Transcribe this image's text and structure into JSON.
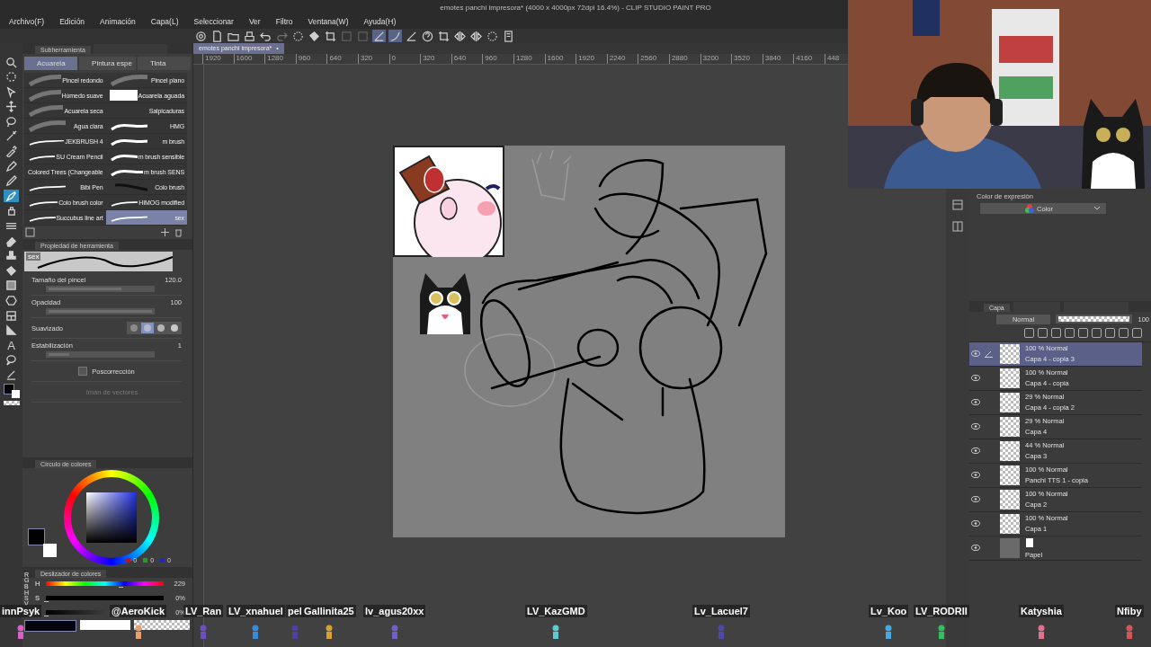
{
  "window": {
    "title": "emotes panchi impresora* (4000 x 4000px 72dpi 16.4%) - CLIP STUDIO PAINT PRO"
  },
  "menu": [
    "Archivo(F)",
    "Edición",
    "Animación",
    "Capa(L)",
    "Seleccionar",
    "Ver",
    "Filtro",
    "Ventana(W)",
    "Ayuda(H)"
  ],
  "toolbar": [
    {
      "kind": "spiral",
      "selected": false
    },
    {
      "kind": "new",
      "selected": false
    },
    {
      "kind": "open",
      "selected": false
    },
    {
      "kind": "print",
      "selected": false
    },
    {
      "kind": "undo",
      "selected": false
    },
    {
      "kind": "redo",
      "selected": false
    },
    {
      "kind": "dots",
      "selected": false
    },
    {
      "kind": "bucket",
      "selected": false
    },
    {
      "kind": "crop",
      "selected": false
    },
    {
      "kind": "square",
      "selected": false
    },
    {
      "kind": "square",
      "selected": false
    },
    {
      "kind": "ruler",
      "selected": true
    },
    {
      "kind": "curve",
      "selected": true
    },
    {
      "kind": "ruler",
      "selected": false
    },
    {
      "kind": "help",
      "selected": false
    },
    {
      "kind": "crop",
      "selected": false
    },
    {
      "kind": "flip",
      "selected": false
    },
    {
      "kind": "flip",
      "selected": false
    },
    {
      "kind": "dots",
      "selected": false
    },
    {
      "kind": "tablet",
      "selected": false
    }
  ],
  "document_tab": {
    "label": "emotes panchi impresora*",
    "close": "•"
  },
  "ruler": [
    "1920",
    "1600",
    "1280",
    "960",
    "640",
    "320",
    "0",
    "320",
    "640",
    "960",
    "1280",
    "1600",
    "1920",
    "2240",
    "2560",
    "2880",
    "3200",
    "3520",
    "3840",
    "4160",
    "448"
  ],
  "tools": [
    {
      "kind": "search",
      "selected": false
    },
    {
      "kind": "dotted",
      "selected": false
    },
    {
      "kind": "cursor",
      "selected": false
    },
    {
      "kind": "move",
      "selected": false
    },
    {
      "kind": "lasso",
      "selected": false
    },
    {
      "kind": "wand",
      "selected": false
    },
    {
      "kind": "dropper",
      "selected": false
    },
    {
      "kind": "pen",
      "selected": false
    },
    {
      "kind": "pencil",
      "selected": false
    },
    {
      "kind": "brush",
      "selected": true
    },
    {
      "kind": "airbrush",
      "selected": false
    },
    {
      "kind": "lines",
      "selected": false
    },
    {
      "kind": "eraser",
      "selected": false
    },
    {
      "kind": "stamp",
      "selected": false
    },
    {
      "kind": "bucket",
      "selected": false
    },
    {
      "kind": "gradient",
      "selected": false
    },
    {
      "kind": "hexagon",
      "selected": false
    },
    {
      "kind": "frame",
      "selected": false
    },
    {
      "kind": "ruler",
      "selected": false
    },
    {
      "kind": "text",
      "glyph": "A",
      "selected": false
    },
    {
      "kind": "balloon",
      "selected": false
    },
    {
      "kind": "line",
      "selected": false
    }
  ],
  "subtool": {
    "title": "Subherramienta",
    "groups": [
      {
        "label": "Acuarela",
        "selected": true
      },
      {
        "label": "Pintura espe",
        "selected": false
      },
      {
        "label": "Tinta",
        "selected": false
      }
    ],
    "brushes": [
      {
        "name": "Pincel redondo",
        "kind": "soft",
        "selected": false
      },
      {
        "name": "Pincel plano",
        "kind": "soft",
        "selected": false
      },
      {
        "name": "Húmedo suave",
        "kind": "soft",
        "selected": false
      },
      {
        "name": "Acuarela aguada",
        "kind": "block",
        "selected": false
      },
      {
        "name": "Acuarela seca",
        "kind": "soft",
        "selected": false
      },
      {
        "name": "Salpicaduras",
        "kind": "none",
        "selected": false
      },
      {
        "name": "Agua clara",
        "kind": "soft",
        "selected": false
      },
      {
        "name": "HMG",
        "kind": "wave",
        "selected": false
      },
      {
        "name": "JEKBRUSH 4",
        "kind": "line",
        "selected": false
      },
      {
        "name": "m brush",
        "kind": "wave",
        "selected": false
      },
      {
        "name": "SU Cream Pencil",
        "kind": "line",
        "selected": false
      },
      {
        "name": "m brush sensible",
        "kind": "wave",
        "selected": false
      },
      {
        "name": "Colored Trees (Changeable",
        "kind": "none",
        "selected": false
      },
      {
        "name": "m brush SENS",
        "kind": "wave",
        "selected": false
      },
      {
        "name": "Bibi Pen",
        "kind": "line",
        "selected": false
      },
      {
        "name": "Colo brush",
        "kind": "dark",
        "selected": false
      },
      {
        "name": "Colo brush color",
        "kind": "line",
        "selected": false
      },
      {
        "name": "HIMOG modified",
        "kind": "line",
        "selected": false
      },
      {
        "name": "Succubus line art",
        "kind": "line",
        "selected": false
      },
      {
        "name": "sex",
        "kind": "line",
        "selected": true
      }
    ]
  },
  "tool_property": {
    "title": "Propiedad de herramienta",
    "preview_label": "sex",
    "rows": [
      {
        "kind": "slider",
        "label": "Tamaño del pincel",
        "value": "120.0",
        "level": 0.7
      },
      {
        "kind": "slider",
        "label": "Opacidad",
        "value": "100",
        "level": 1.0
      },
      {
        "kind": "choice",
        "label": "Suavizado",
        "options": [
          {
            "selected": false
          },
          {
            "selected": true
          },
          {
            "selected": false
          },
          {
            "selected": false
          }
        ]
      },
      {
        "kind": "slider",
        "label": "Estabilización",
        "value": "1",
        "level": 0.2
      },
      {
        "kind": "checkbox",
        "label": "Poscorrección",
        "checked": false,
        "disabled": false
      },
      {
        "kind": "checkbox",
        "label": "Imán de vectores",
        "disabled": true
      }
    ]
  },
  "color_wheel": {
    "title": "Círculo de colores",
    "readouts": [
      {
        "value": "0",
        "color": "#c0141c"
      },
      {
        "value": "0",
        "color": "#1ca024"
      },
      {
        "value": "0",
        "color": "#1c28c8"
      }
    ]
  },
  "color_slider": {
    "title": "Deslizador de colores",
    "modes": [
      "RGB",
      "HSV"
    ],
    "rows": [
      {
        "kind": "hue",
        "label": "H",
        "value": "229",
        "level": 0.63
      },
      {
        "kind": "saturation",
        "label": "S",
        "value": "0%",
        "level": 0
      },
      {
        "kind": "value",
        "value": "0%",
        "level": 0
      }
    ]
  },
  "expression_color": {
    "title": "Color de expresión",
    "value": "Color"
  },
  "layers": {
    "tab": "Capa",
    "blend": "Normal",
    "opacity": "100",
    "opacity_bar": {
      "level": 1.0
    },
    "items": [
      {
        "kind": "raster",
        "mode": "100 % Normal",
        "name": "Capa 4 - copia 3",
        "selected": true,
        "visible": true
      },
      {
        "kind": "raster",
        "mode": "100 % Normal",
        "name": "Capa 4 - copia",
        "selected": false,
        "visible": true
      },
      {
        "kind": "raster",
        "mode": "29 % Normal",
        "name": "Capa 4 - copia 2",
        "selected": false,
        "visible": true
      },
      {
        "kind": "raster",
        "mode": "29 % Normal",
        "name": "Capa 4",
        "selected": false,
        "visible": true
      },
      {
        "kind": "raster",
        "mode": "44 % Normal",
        "name": "Capa 3",
        "selected": false,
        "visible": true
      },
      {
        "kind": "raster",
        "mode": "100 % Normal",
        "name": "Panchi TTS 1 - copia",
        "selected": false,
        "visible": true
      },
      {
        "kind": "raster",
        "mode": "100 % Normal",
        "name": "Capa 2",
        "selected": false,
        "visible": true
      },
      {
        "kind": "raster",
        "mode": "100 % Normal",
        "name": "Capa 1",
        "selected": false,
        "visible": true
      },
      {
        "kind": "paper",
        "name": "Papel",
        "selected": false,
        "visible": true
      }
    ]
  },
  "webcam": {
    "kind": "picture"
  },
  "chatters": [
    {
      "name": "innPsyk",
      "color": "#d860c8"
    },
    {
      "name": "@AeroKick",
      "color": "#e8a070"
    },
    {
      "name": "LV_Ran",
      "color": "#6a50c0"
    },
    {
      "name": "LV_xnahuel",
      "color": "#3a8ad8"
    },
    {
      "name": "pel",
      "color": "#5040a0"
    },
    {
      "name": "Gallinita25",
      "color": "#d8a030"
    },
    {
      "name": "lv_agus20xx",
      "color": "#7060c8"
    },
    {
      "name": "LV_KazGMD",
      "color": "#60c8d0"
    },
    {
      "name": "Lv_Lacuel7",
      "color": "#5048a8"
    },
    {
      "name": "Lv_Koo",
      "color": "#48a8e0"
    },
    {
      "name": "LV_RODRII",
      "color": "#30c060"
    },
    {
      "name": "Katyshia",
      "color": "#e07090"
    },
    {
      "name": "Nfiby",
      "color": "#d05858"
    }
  ]
}
